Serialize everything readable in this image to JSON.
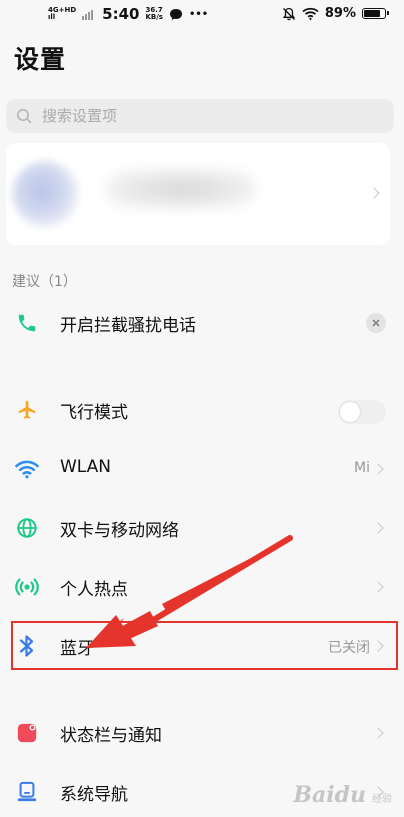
{
  "status_bar": {
    "network_top": "4G+HD",
    "network_bottom": "ıll",
    "time": "5:40",
    "speed_value": "36.7",
    "speed_unit": "KB/s",
    "more": "•••",
    "battery_text": "89%",
    "battery_level": 0.89
  },
  "page": {
    "title": "设置"
  },
  "search": {
    "placeholder": "搜索设置项",
    "value": ""
  },
  "suggestions": {
    "label": "建议（1）",
    "items": [
      {
        "label": "开启拦截骚扰电话",
        "icon": "phone-icon"
      }
    ]
  },
  "settings": {
    "items": [
      {
        "label": "飞行模式",
        "icon": "airplane-icon",
        "toggle_on": false
      },
      {
        "label": "WLAN",
        "icon": "wifi-icon",
        "value": "Mi"
      },
      {
        "label": "双卡与移动网络",
        "icon": "globe-icon",
        "value": ""
      },
      {
        "label": "个人热点",
        "icon": "hotspot-icon",
        "value": ""
      },
      {
        "label": "蓝牙",
        "icon": "bluetooth-icon",
        "value": "已关闭"
      },
      {
        "label": "状态栏与通知",
        "icon": "notification-icon",
        "value": ""
      },
      {
        "label": "系统导航",
        "icon": "navigation-icon",
        "value": ""
      }
    ]
  },
  "watermark": {
    "logo": "Baidu",
    "sub": "经验"
  },
  "colors": {
    "accent_green": "#1ec98b",
    "airplane": "#f6a623",
    "wifi": "#2f8ef0",
    "bluetooth": "#3b7be8",
    "notification": "#f04a5b",
    "annotation_red": "#e5342b"
  }
}
